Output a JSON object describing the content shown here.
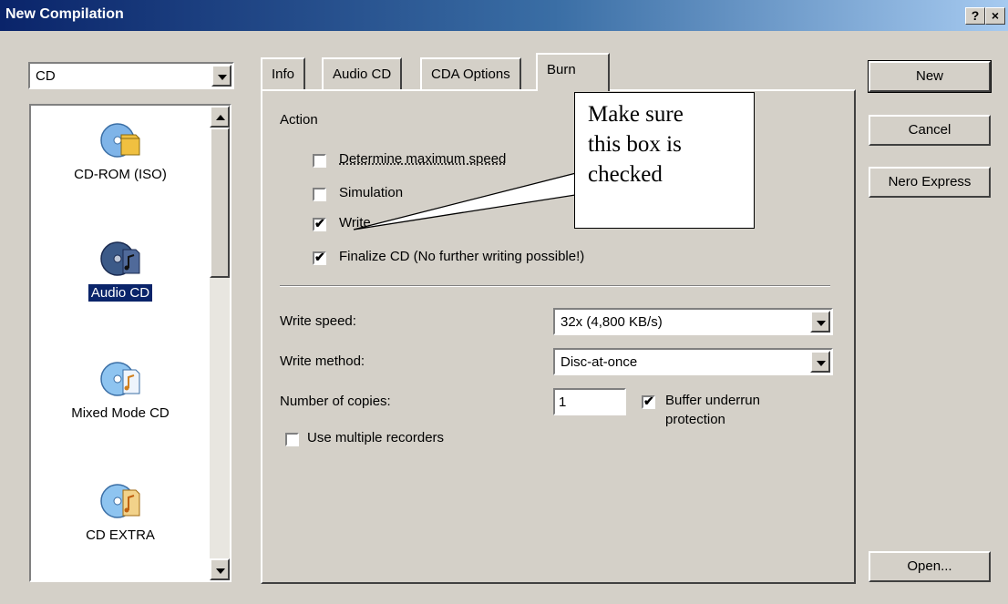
{
  "window": {
    "title": "New Compilation",
    "help_label": "?",
    "close_label": "×"
  },
  "left": {
    "category_combo": {
      "value": "CD"
    },
    "list_items": [
      {
        "label": "CD-ROM (ISO)",
        "icon": "cd-rom-iso-icon",
        "selected": false
      },
      {
        "label": "Audio CD",
        "icon": "audio-cd-icon",
        "selected": true
      },
      {
        "label": "Mixed Mode CD",
        "icon": "mixed-mode-cd-icon",
        "selected": false
      },
      {
        "label": "CD EXTRA",
        "icon": "cd-extra-icon",
        "selected": false
      }
    ]
  },
  "tabs": [
    {
      "label": "Info",
      "active": false
    },
    {
      "label": "Audio CD",
      "active": false
    },
    {
      "label": "CDA Options",
      "active": false
    },
    {
      "label": "Burn",
      "active": true
    }
  ],
  "burn": {
    "action_label": "Action",
    "checkboxes": [
      {
        "label": "Determine maximum speed",
        "checked": false
      },
      {
        "label": "Simulation",
        "checked": false
      },
      {
        "label": "Write",
        "checked": true
      },
      {
        "label": "Finalize CD (No further writing possible!)",
        "checked": true
      }
    ],
    "write_speed_label": "Write speed:",
    "write_speed_value": "32x (4,800 KB/s)",
    "write_method_label": "Write method:",
    "write_method_value": "Disc-at-once",
    "copies_label": "Number of copies:",
    "copies_value": "1",
    "buffer_underrun": {
      "line1": "Buffer underrun",
      "line2": "protection",
      "checked": true
    },
    "multiple_recorders": {
      "label": "Use multiple recorders",
      "checked": false
    }
  },
  "callout": {
    "line1": "Make sure",
    "line2": "this box is",
    "line3": "checked"
  },
  "buttons": {
    "new": "New",
    "cancel": "Cancel",
    "nero_express": "Nero Express",
    "open": "Open..."
  }
}
